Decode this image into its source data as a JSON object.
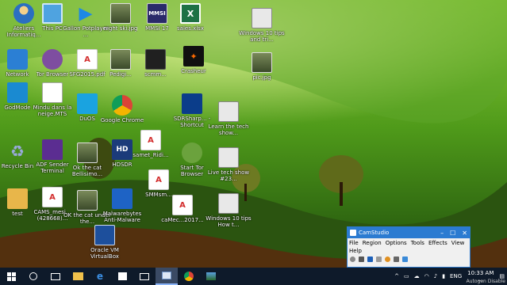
{
  "desktop": {
    "icons": [
      {
        "label": "Ateliers Informatiq...",
        "icon": "user-folder-icon"
      },
      {
        "label": "This PC",
        "icon": "computer-icon"
      },
      {
        "label": "Gallon Potplayer ...",
        "icon": "media-player-icon"
      },
      {
        "label": "night ski.jpg",
        "icon": "image-icon"
      },
      {
        "label": "MMSI 17",
        "icon": "mmsi-icon"
      },
      {
        "label": "sales.xlsx",
        "icon": "excel-icon"
      },
      {
        "label": "Windows 10 tips and tri...",
        "icon": "video-thumbnail-icon"
      },
      {
        "label": "Network",
        "icon": "network-icon"
      },
      {
        "label": "Tor Browser",
        "icon": "tor-browser-icon"
      },
      {
        "label": "SFG2015.pdf",
        "icon": "pdf-icon"
      },
      {
        "label": "Pedigi...",
        "icon": "image-icon"
      },
      {
        "label": "scmm...",
        "icon": "dark-image-icon"
      },
      {
        "label": "Crasheur",
        "icon": "obs-icon"
      },
      {
        "label": "pic.jpg",
        "icon": "image-icon"
      },
      {
        "label": "GodMode",
        "icon": "godmode-icon"
      },
      {
        "label": "Mindu dans la neige.MTS",
        "icon": "video-file-icon"
      },
      {
        "label": "DuOS",
        "icon": "duos-icon"
      },
      {
        "label": "Google Chrome",
        "icon": "chrome-icon"
      },
      {
        "label": "SDRSharp... - Shortcut",
        "icon": "sdrsharp-icon"
      },
      {
        "label": "Learn the tech show...",
        "icon": "video-file-icon"
      },
      {
        "label": "Recycle Bin",
        "icon": "recycle-bin-icon"
      },
      {
        "label": "ADF Sender Terminal",
        "icon": "adf-icon"
      },
      {
        "label": "Ok the cat Bellisimo...",
        "icon": "image-icon"
      },
      {
        "label": "HDSDR",
        "icon": "hdsdr-icon"
      },
      {
        "label": "samet_Ridi...",
        "icon": "pdf-icon"
      },
      {
        "label": "Start Tor Browser",
        "icon": "tor-start-icon"
      },
      {
        "label": "Live tech show #23...",
        "icon": "video-file-icon"
      },
      {
        "label": "test",
        "icon": "folder-icon"
      },
      {
        "label": "CAMS_mesi... (428668)...",
        "icon": "pdf-icon"
      },
      {
        "label": "OK the cat under the...",
        "icon": "image-icon"
      },
      {
        "label": "Malwarebytes Anti-Malware",
        "icon": "malwarebytes-icon"
      },
      {
        "label": "SMMsm...",
        "icon": "pdf-icon"
      },
      {
        "label": "caMec...2017...",
        "icon": "pdf-icon"
      },
      {
        "label": "Windows 10 tips How t...",
        "icon": "video-thumbnail-icon"
      },
      {
        "label": "Oracle VM VirtualBox",
        "icon": "virtualbox-icon"
      }
    ]
  },
  "camstudio": {
    "title": "CamStudio",
    "controls": [
      "–",
      "☐",
      "✕"
    ],
    "menu": [
      "File",
      "Region",
      "Options",
      "Tools",
      "Effects",
      "View",
      "Help"
    ]
  },
  "taskbar": {
    "tray": {
      "chevron": "^",
      "language": "ENG",
      "time": "10:33 AM",
      "date": "..."
    },
    "autogen_text": "Autogen Disable"
  }
}
